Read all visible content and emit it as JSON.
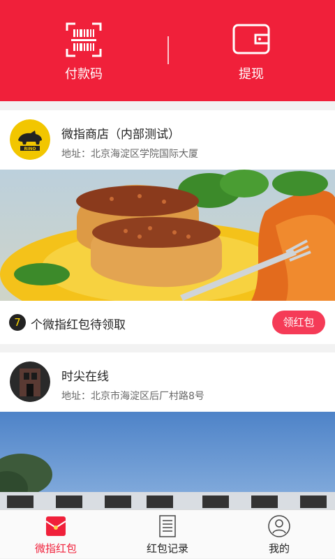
{
  "header": {
    "pay_code_label": "付款码",
    "withdraw_label": "提现"
  },
  "shops": [
    {
      "name": "微指商店（内部测试）",
      "address": "地址：北京海淀区学院国际大厦",
      "logo_icon": "rhino-logo",
      "banner_image": "cake-on-orange-plate",
      "red_packet_count": "7",
      "red_packet_text": "个微指红包待领取",
      "claim_button": "领红包"
    },
    {
      "name": "时尖在线",
      "address": "地址：北京市海淀区后厂村路8号",
      "logo_icon": "building-photo",
      "banner_image": "sky-and-signboard"
    }
  ],
  "tabbar": {
    "active_color": "#f0203a",
    "tabs": [
      {
        "label": "微指红包",
        "icon": "red-envelope-icon"
      },
      {
        "label": "红包记录",
        "icon": "document-icon"
      },
      {
        "label": "我的",
        "icon": "user-icon"
      }
    ]
  },
  "colors": {
    "brand_red": "#f0203a",
    "button_red": "#f53b57"
  }
}
